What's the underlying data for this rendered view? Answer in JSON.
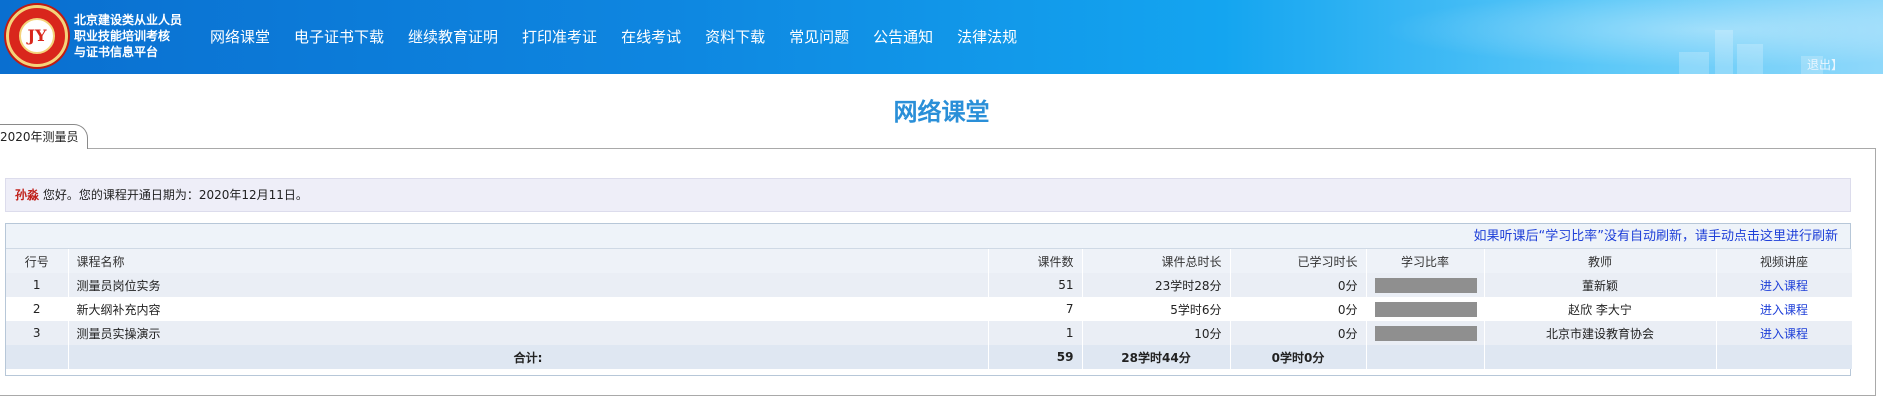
{
  "header": {
    "logo_text": "JY",
    "site_title_lines": [
      "北京建设类从业人员",
      "职业技能培训考核",
      "与证书信息平台"
    ],
    "nav": [
      "网络课堂",
      "电子证书下载",
      "继续教育证明",
      "打印准考证",
      "在线考试",
      "资料下载",
      "常见问题",
      "公告通知",
      "法律法规"
    ],
    "logout": "退出】"
  },
  "page_title": "网络课堂",
  "tab_label": "2020年测量员",
  "greeting": {
    "name": "孙淼",
    "message": " 您好。您的课程开通日期为：2020年12月11日。"
  },
  "table": {
    "refresh_text": "如果听课后“学习比率”没有自动刷新，请手动点击这里进行刷新",
    "columns": [
      "行号",
      "课程名称",
      "课件数",
      "课件总时长",
      "已学习时长",
      "学习比率",
      "教师",
      "视频讲座"
    ],
    "rows": [
      {
        "no": "1",
        "name": "测量员岗位实务",
        "count": "51",
        "total": "23学时28分",
        "learned": "0分",
        "ratio": 0,
        "teacher": "董新颖",
        "action": "进入课程"
      },
      {
        "no": "2",
        "name": "新大纲补充内容",
        "count": "7",
        "total": "5学时6分",
        "learned": "0分",
        "ratio": 0,
        "teacher": "赵欣 李大宁",
        "action": "进入课程"
      },
      {
        "no": "3",
        "name": "测量员实操演示",
        "count": "1",
        "total": "10分",
        "learned": "0分",
        "ratio": 0,
        "teacher": "北京市建设教育协会",
        "action": "进入课程"
      }
    ],
    "summary": {
      "label": "合计:",
      "count": "59",
      "total": "28学时44分",
      "learned": "0学时0分"
    }
  },
  "colors": {
    "accent": "#2a8fd8",
    "link": "#1e3fd8",
    "username": "#c0211b",
    "ratio_bar": "#8f8f8f"
  }
}
